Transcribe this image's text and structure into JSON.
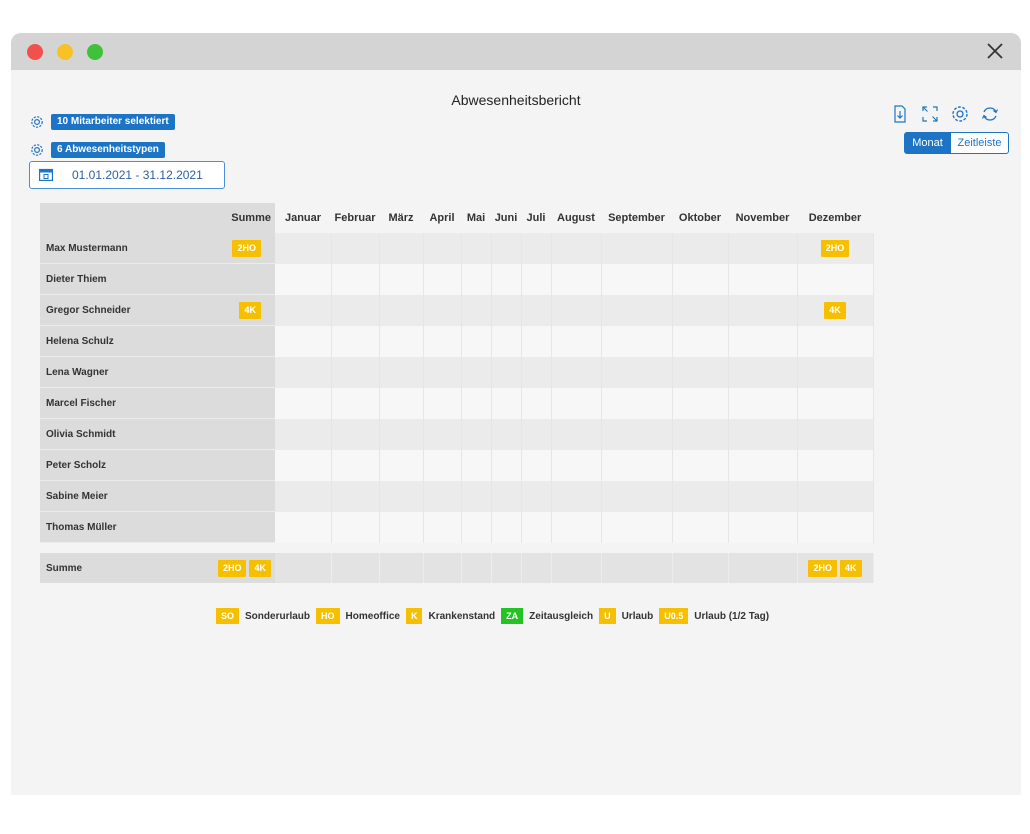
{
  "window": {
    "title_bar_buttons": [
      "close",
      "minimize",
      "maximize"
    ],
    "close_glyph": "×"
  },
  "report": {
    "title": "Abwesenheitsbericht"
  },
  "filters": {
    "employees_badge": "10 Mitarbeiter selektiert",
    "types_badge": "6 Abwesenheitstypen",
    "date_range": "01.01.2021 - 31.12.2021"
  },
  "toolbar": {
    "icons": [
      "export-icon",
      "expand-icon",
      "settings-icon",
      "refresh-icon"
    ],
    "view_month": "Monat",
    "view_timeline": "Zeitleiste"
  },
  "table": {
    "sum_header": "Summe",
    "months": [
      "Januar",
      "Februar",
      "März",
      "April",
      "Mai",
      "Juni",
      "Juli",
      "August",
      "September",
      "Oktober",
      "November",
      "Dezember"
    ],
    "rows": [
      {
        "name": "Max Mustermann",
        "sum": "2HO",
        "dezember": "2HO"
      },
      {
        "name": "Dieter Thiem",
        "sum": "",
        "dezember": ""
      },
      {
        "name": "Gregor Schneider",
        "sum": "4K",
        "dezember": "4K"
      },
      {
        "name": "Helena Schulz",
        "sum": "",
        "dezember": ""
      },
      {
        "name": "Lena Wagner",
        "sum": "",
        "dezember": ""
      },
      {
        "name": "Marcel Fischer",
        "sum": "",
        "dezember": ""
      },
      {
        "name": "Olivia Schmidt",
        "sum": "",
        "dezember": ""
      },
      {
        "name": "Peter Scholz",
        "sum": "",
        "dezember": ""
      },
      {
        "name": "Sabine Meier",
        "sum": "",
        "dezember": ""
      },
      {
        "name": "Thomas Müller",
        "sum": "",
        "dezember": ""
      }
    ],
    "total": {
      "label": "Summe",
      "sum": [
        "2HO",
        "4K"
      ],
      "dezember": [
        "2HO",
        "4K"
      ]
    }
  },
  "legend": [
    {
      "code": "SO",
      "label": "Sonderurlaub",
      "color": "#f6c000"
    },
    {
      "code": "HO",
      "label": "Homeoffice",
      "color": "#f6c000"
    },
    {
      "code": "K",
      "label": "Krankenstand",
      "color": "#f6c000"
    },
    {
      "code": "ZA",
      "label": "Zeitausgleich",
      "color": "#22c322"
    },
    {
      "code": "U",
      "label": "Urlaub",
      "color": "#f6c000"
    },
    {
      "code": "U0.5",
      "label": "Urlaub (1/2 Tag)",
      "color": "#f6c000"
    }
  ],
  "colors": {
    "accent": "#1e74c4",
    "pill": "#f6c000",
    "green": "#22c322"
  }
}
